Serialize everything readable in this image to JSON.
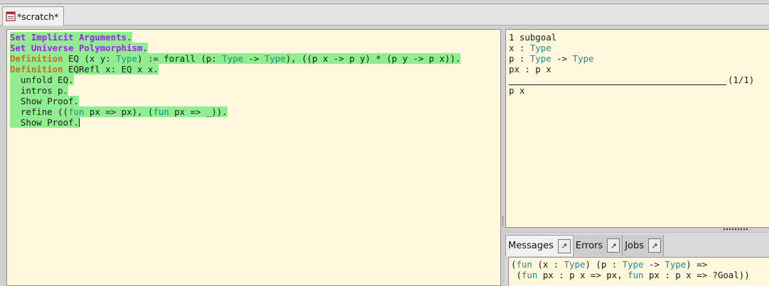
{
  "tab": {
    "label": "*scratch*",
    "icon": "document-icon"
  },
  "script": {
    "lines": [
      [
        {
          "t": "Set Implicit Arguments",
          "c": "kw"
        },
        {
          "t": ".",
          "c": "plain"
        }
      ],
      [
        {
          "t": "Set Universe Polymorphism",
          "c": "kw"
        },
        {
          "t": ".",
          "c": "plain"
        }
      ],
      [
        {
          "t": "Definition",
          "c": "def"
        },
        {
          "t": " EQ (x y: ",
          "c": "plain"
        },
        {
          "t": "Type",
          "c": "ty"
        },
        {
          "t": ") := forall (p: ",
          "c": "plain"
        },
        {
          "t": "Type",
          "c": "ty"
        },
        {
          "t": " -> ",
          "c": "plain"
        },
        {
          "t": "Type",
          "c": "ty"
        },
        {
          "t": "), ((p x -> p y) * (p y -> p x)).",
          "c": "plain"
        }
      ],
      [
        {
          "t": "Definition",
          "c": "def"
        },
        {
          "t": " EQRefl x: EQ x x.",
          "c": "plain"
        }
      ],
      [
        {
          "t": "  unfold EQ.",
          "c": "plain"
        }
      ],
      [
        {
          "t": "  intros p.",
          "c": "plain"
        }
      ],
      [
        {
          "t": "  Show Proof.",
          "c": "plain"
        }
      ],
      [
        {
          "t": "  refine ((",
          "c": "plain"
        },
        {
          "t": "fun",
          "c": "ty"
        },
        {
          "t": " px => px), (",
          "c": "plain"
        },
        {
          "t": "fun",
          "c": "ty"
        },
        {
          "t": " px => _)).",
          "c": "plain"
        }
      ],
      [
        {
          "t": "  Show Proof.",
          "c": "plain"
        }
      ]
    ]
  },
  "goals": {
    "header": "1 subgoal",
    "hyps": [
      [
        {
          "t": "x : ",
          "c": "plain"
        },
        {
          "t": "Type",
          "c": "ty"
        }
      ],
      [
        {
          "t": "p : ",
          "c": "plain"
        },
        {
          "t": "Type",
          "c": "ty"
        },
        {
          "t": " -> ",
          "c": "plain"
        },
        {
          "t": "Type",
          "c": "ty"
        }
      ],
      [
        {
          "t": "px : p x",
          "c": "plain"
        }
      ]
    ],
    "counter": "(1/1)",
    "conclusion": "p x"
  },
  "notebook": {
    "tabs": [
      {
        "label": "Messages",
        "active": true
      },
      {
        "label": "Errors",
        "active": false
      },
      {
        "label": "Jobs",
        "active": false
      }
    ],
    "detach_glyph": "↗",
    "message_lines": [
      [
        {
          "t": "(",
          "c": "plain"
        },
        {
          "t": "fun",
          "c": "ty"
        },
        {
          "t": " (x : ",
          "c": "plain"
        },
        {
          "t": "Type",
          "c": "ty"
        },
        {
          "t": ") (p : ",
          "c": "plain"
        },
        {
          "t": "Type",
          "c": "ty"
        },
        {
          "t": " -> ",
          "c": "plain"
        },
        {
          "t": "Type",
          "c": "ty"
        },
        {
          "t": ") =>",
          "c": "plain"
        }
      ],
      [
        {
          "t": " (",
          "c": "plain"
        },
        {
          "t": "fun",
          "c": "ty"
        },
        {
          "t": " px : p x => px, ",
          "c": "plain"
        },
        {
          "t": "fun",
          "c": "ty"
        },
        {
          "t": " px : p x => ?Goal))",
          "c": "plain"
        }
      ]
    ]
  },
  "colors": {
    "keyword": "#a020f0",
    "definition": "#d2691e",
    "type": "#228b8b",
    "processed": "#90ee90",
    "background": "#fff8dc"
  }
}
